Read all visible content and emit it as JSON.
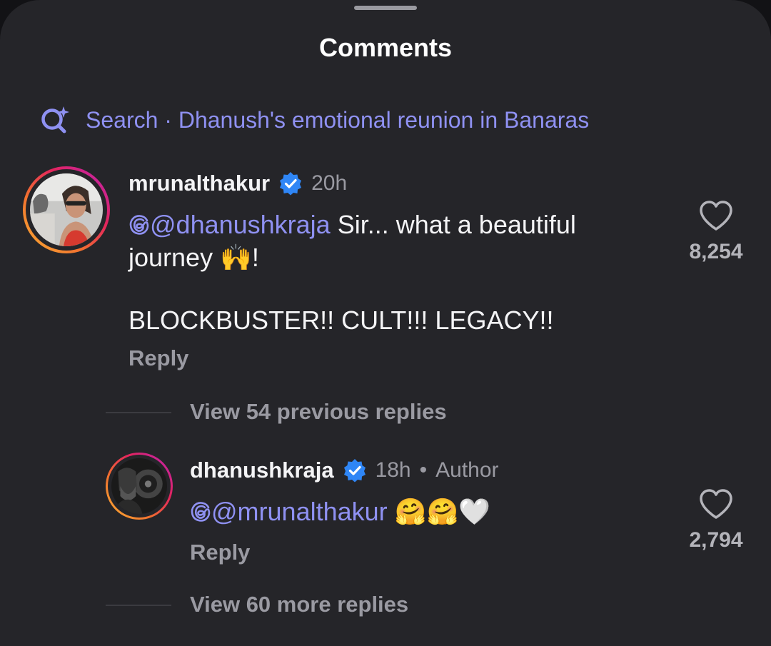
{
  "header": {
    "title": "Comments"
  },
  "search": {
    "label": "Search · Dhanush's emotional reunion in Banaras"
  },
  "comments": [
    {
      "username": "mrunalthakur",
      "verified": true,
      "time": "20h",
      "mention": "@dhanushkraja",
      "text_line1": "Sir... what a beautiful",
      "text_line2": "journey 🙌!",
      "text_line3": "BLOCKBUSTER!! CULT!!! LEGACY!!",
      "reply_label": "Reply",
      "like_count": "8,254"
    }
  ],
  "replies_link_previous": "View 54 previous replies",
  "reply": {
    "username": "dhanushkraja",
    "verified": true,
    "time": "18h",
    "separator": "•",
    "author_tag": "Author",
    "mention": "@mrunalthakur",
    "emojis": "🤗🤗🤍",
    "reply_label": "Reply",
    "like_count": "2,794"
  },
  "replies_link_more": "View 60 more replies",
  "colors": {
    "background": "#252529",
    "accent": "#8f91f2",
    "verified": "#2f86f6",
    "muted": "#9a9aa2"
  },
  "icons": {
    "search": "ai-search-icon",
    "verified": "verified-badge-icon",
    "like": "heart-outline-icon",
    "mention": "threads-icon"
  }
}
